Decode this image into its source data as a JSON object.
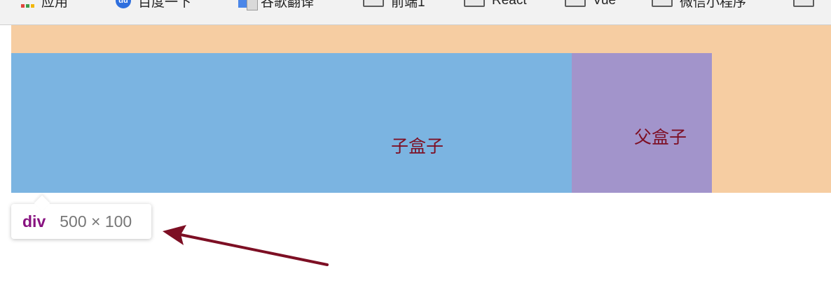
{
  "bookmarks": {
    "items": [
      {
        "label": "应用",
        "icon": "apps-grid-icon"
      },
      {
        "label": "百度一下",
        "icon": "baidu-icon"
      },
      {
        "label": "谷歌翻译",
        "icon": "translate-icon"
      },
      {
        "label": "前端1",
        "icon": "folder-icon"
      },
      {
        "label": "React",
        "icon": "folder-icon"
      },
      {
        "label": "Vue",
        "icon": "folder-icon"
      },
      {
        "label": "微信小程序",
        "icon": "folder-icon"
      }
    ]
  },
  "demo": {
    "child_label": "子盒子",
    "parent_label": "父盒子",
    "colors": {
      "outer": "#f6cda2",
      "child": "#7bb4e1",
      "parent": "#a294cb",
      "text": "#7d0f24"
    }
  },
  "tooltip": {
    "tag": "div",
    "dimensions": "500 × 100"
  },
  "annotation": {
    "arrow_color": "#7d0f24"
  }
}
